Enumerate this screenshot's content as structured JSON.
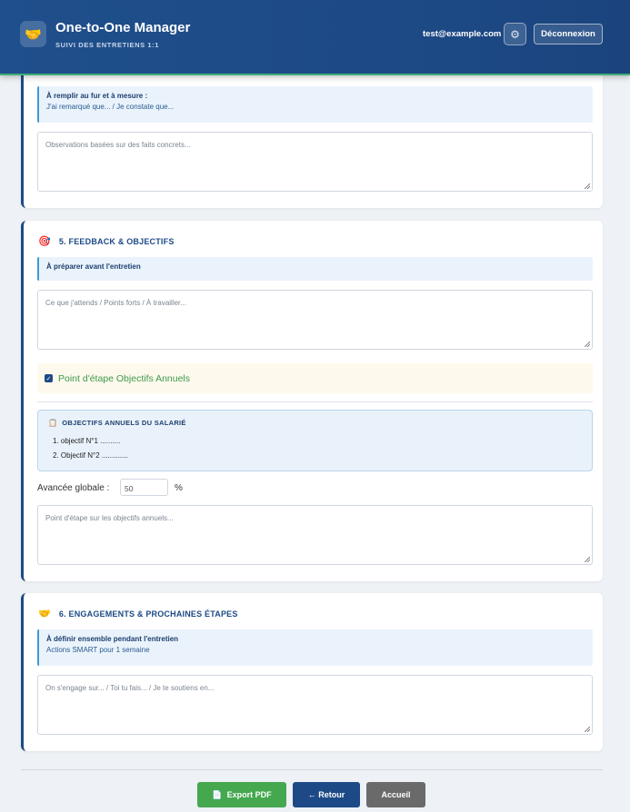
{
  "header": {
    "logo_icon": "🤝",
    "title": "One-to-One Manager",
    "subtitle": "SUIVI DES ENTRETIENS 1:1",
    "user_email": "test@example.com",
    "settings_icon": "⚙",
    "logout_label": "Déconnexion"
  },
  "section4": {
    "info_title": "À remplir au fur et à mesure :",
    "info_sub": "J'ai remarqué que... / Je constate que...",
    "textarea_placeholder": "Observations basées sur des faits concrets..."
  },
  "section5": {
    "icon": "🎯",
    "title": "5. FEEDBACK & OBJECTIFS",
    "info_title": "À préparer avant l'entretien",
    "textarea_placeholder": "Ce que j'attends / Points forts / À travailler...",
    "checkbox_checked": true,
    "checkbox_label": "Point d'étape Objectifs Annuels",
    "objectives_icon": "📋",
    "objectives_title": "OBJECTIFS ANNUELS DU SALARIÉ",
    "objectives": [
      "1. objectif N°1 ..........",
      "2. Objectif N°2 ............."
    ],
    "progress_label": "Avancée globale :",
    "progress_value": "50",
    "progress_unit": "%",
    "annual_placeholder": "Point d'étape sur les objectifs annuels..."
  },
  "section6": {
    "icon": "🤝",
    "title": "6. ENGAGEMENTS & PROCHAINES ÉTAPES",
    "info_title": "À définir ensemble pendant l'entretien",
    "info_sub": "Actions SMART pour 1 semaine",
    "textarea_placeholder": "On s'engage sur... / Toi tu fais... / Je te soutiens en..."
  },
  "footer": {
    "export_icon": "📄",
    "export_label": "Export PDF",
    "back_label": "← Retour",
    "home_label": "Accueil"
  },
  "colors": {
    "header_bg": "#1d4a86",
    "accent_green": "#45a84f",
    "info_bg": "#eaf3fc"
  }
}
